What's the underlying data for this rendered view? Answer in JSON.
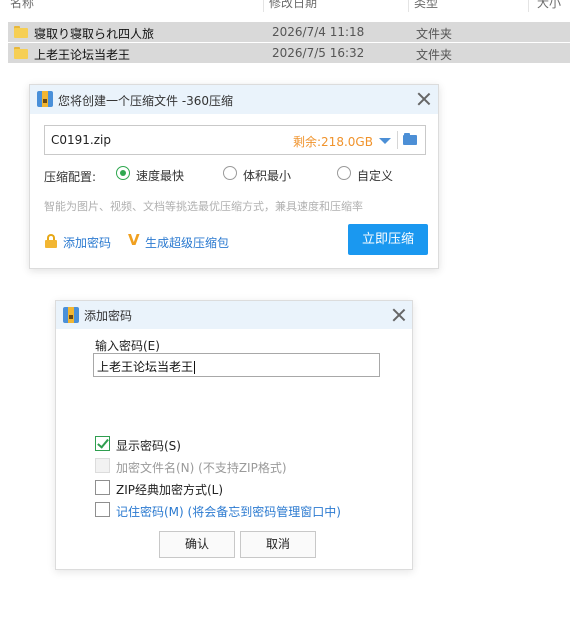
{
  "explorer": {
    "headers": {
      "name": "名称",
      "date": "修改日期",
      "type": "类型",
      "size": "大小"
    },
    "rows": [
      {
        "name": "寝取り寝取られ四人旅",
        "date": "2026/7/4 11:18",
        "type": "文件夹"
      },
      {
        "name": "上老王论坛当老王",
        "date": "2026/7/5 16:32",
        "type": "文件夹"
      }
    ]
  },
  "zip_dialog": {
    "title": "您将创建一个压缩文件 -360压缩",
    "filename": "C0191.zip",
    "space_left": "剩余:218.0GB",
    "config_label": "压缩配置:",
    "options": [
      "速度最快",
      "体积最小",
      "自定义"
    ],
    "selected_option": "速度最快",
    "hint": "智能为图片、视频、文档等挑选最优压缩方式，兼具速度和压缩率",
    "add_password": "添加密码",
    "super_pack": "生成超级压缩包",
    "compress_button": "立即压缩",
    "colors": {
      "accent": "#1a98f0",
      "space": "#f0932c",
      "link": "#2b7ad0"
    }
  },
  "password_dialog": {
    "title": "添加密码",
    "input_label": "输入密码(E)",
    "password_value": "上老王论坛当老王",
    "checkboxes": [
      {
        "label": "显示密码(S)",
        "checked": true,
        "disabled": false
      },
      {
        "label": "加密文件名(N) (不支持ZIP格式)",
        "checked": false,
        "disabled": true
      },
      {
        "label": "ZIP经典加密方式(L)",
        "checked": false,
        "disabled": false
      },
      {
        "label": "记住密码(M) (将会备忘到密码管理窗口中)",
        "checked": false,
        "disabled": false
      }
    ],
    "ok_button": "确认",
    "cancel_button": "取消"
  }
}
